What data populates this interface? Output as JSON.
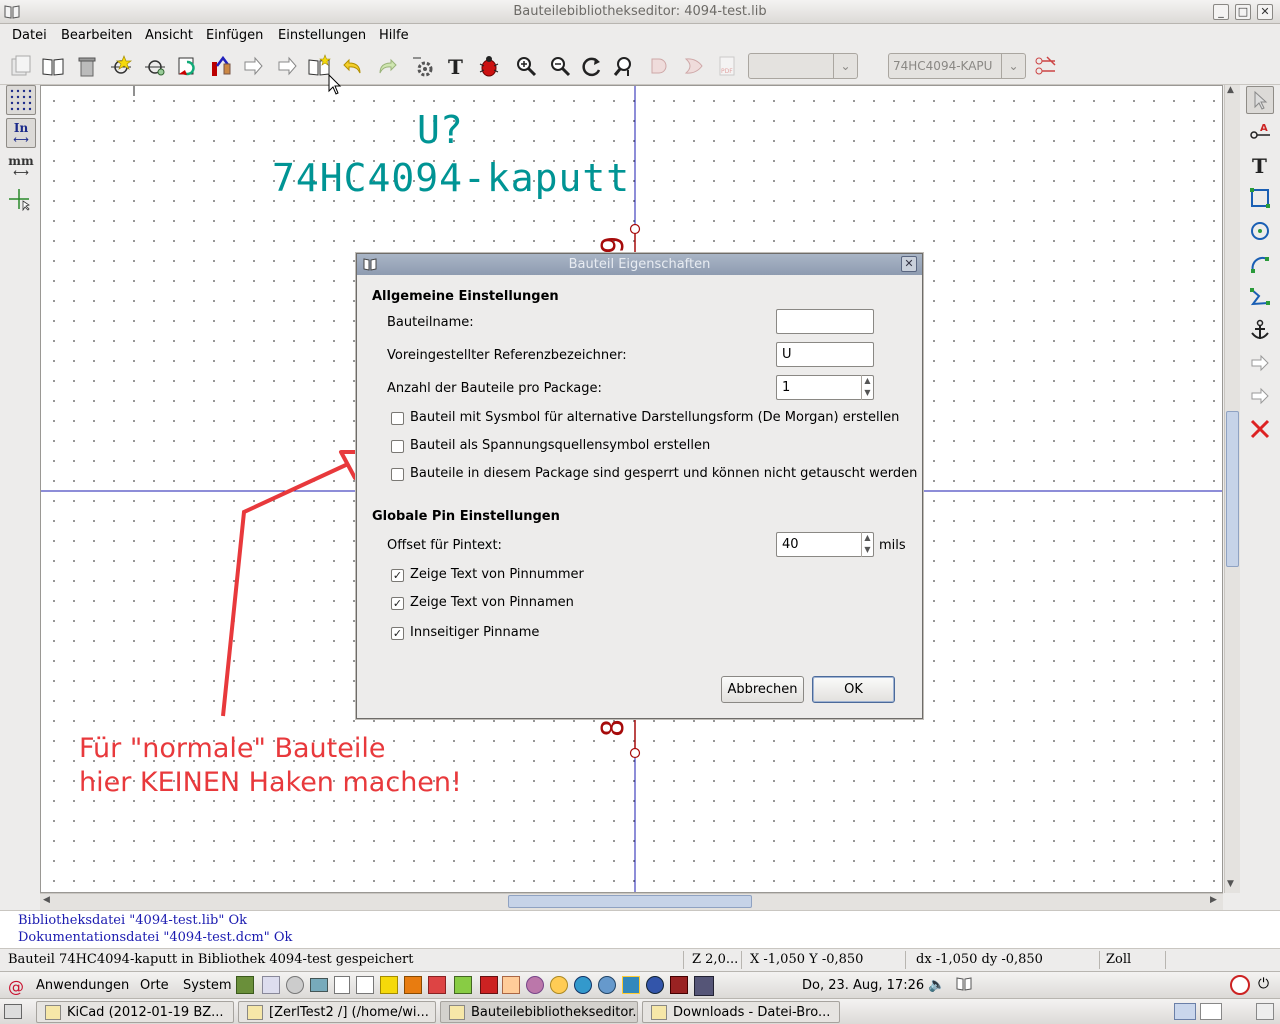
{
  "window": {
    "title": "Bauteilebibliothekseditor: 4094-test.lib"
  },
  "menu": [
    "Datei",
    "Bearbeiten",
    "Ansicht",
    "Einfügen",
    "Einstellungen",
    "Hilfe"
  ],
  "toolbar": {
    "part_select_value": "",
    "alias_select_value": "74HC4094-KAPU",
    "icons": [
      "save-library-icon",
      "current-library-icon",
      "delete-component-icon",
      "new-component-icon",
      "load-component-icon",
      "import-icon",
      "export-icon",
      "save-component-icon",
      "undo-icon",
      "redo-icon",
      "properties-icon",
      "text-icon",
      "check-icon",
      "zoom-in-icon",
      "zoom-out-icon",
      "zoom-redraw-icon",
      "zoom-fit-icon",
      "body-normal-icon",
      "body-demorgan-icon",
      "pdf-icon",
      "pin-table-icon"
    ]
  },
  "canvas": {
    "reference": "U?",
    "value": "74HC4094-kaputt",
    "pin_top_number": "9",
    "pin_bottom_number": "8",
    "annotation_line1": "Für \"normale\" Bauteile",
    "annotation_line2": "hier KEINEN Haken machen!",
    "annotation_color": "#e8393c",
    "text_color": "#009494",
    "pin_color": "#a60b0b",
    "axis_color": "#1b1bb0"
  },
  "leftbar": {
    "units_inch_label": "In",
    "units_mm_label": "mm"
  },
  "dialog": {
    "title": "Bauteil Eigenschaften",
    "section_general": "Allgemeine Einstellungen",
    "name_label": "Bauteilname:",
    "name_value": "",
    "ref_label": "Voreingestellter Referenzbezeichner:",
    "ref_value": "U",
    "count_label": "Anzahl der Bauteile pro Package:",
    "count_value": "1",
    "cb_demorgan": "Bauteil mit Sysmbol für alternative Darstellungsform (De Morgan) erstellen",
    "cb_power": "Bauteil als Spannungsquellensymbol erstellen",
    "cb_locked": "Bauteile in diesem Package sind gesperrt und können nicht getauscht werden",
    "section_pins": "Globale Pin Einstellungen",
    "offset_label": "Offset für Pintext:",
    "offset_value": "40",
    "offset_unit": "mils",
    "cb_pinnum": "Zeige Text von Pinnummer",
    "cb_pinname": "Zeige Text von Pinnamen",
    "cb_inside": "Innseitiger Pinname",
    "cancel_label": "Abbrechen",
    "ok_label": "OK",
    "checked": {
      "demorgan": false,
      "power": false,
      "locked": false,
      "pinnum": true,
      "pinname": true,
      "inside": true
    }
  },
  "messages": {
    "line1": "Bibliotheksdatei \"4094-test.lib\" Ok",
    "line2": "Dokumentationsdatei \"4094-test.dcm\" Ok"
  },
  "status": {
    "main": "Bauteil 74HC4094-kaputt in Bibliothek 4094-test gespeichert",
    "zoom": "Z 2,0...",
    "xy": "X -1,050  Y -0,850",
    "dxdy": "dx -1,050  dy -0,850",
    "units": "Zoll"
  },
  "top_panel": {
    "applications": "Anwendungen",
    "places": "Orte",
    "system": "System",
    "clock": "Do, 23. Aug, 17:26"
  },
  "taskbar": [
    {
      "label": "KiCad (2012-01-19 BZ...",
      "active": false
    },
    {
      "label": "[ZerlTest2 /] (/home/wi...",
      "active": false
    },
    {
      "label": "Bauteilebibliothekseditor...",
      "active": true
    },
    {
      "label": "Downloads - Datei-Bro...",
      "active": false
    }
  ]
}
